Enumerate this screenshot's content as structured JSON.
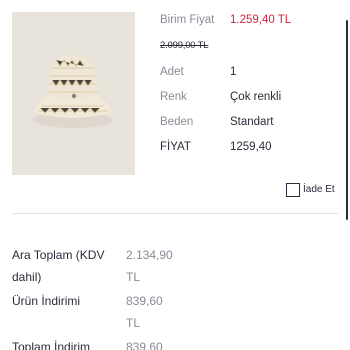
{
  "product": {
    "image_alt": "bucket hat",
    "unit_price_label": "Birim Fiyat",
    "unit_price_value": "1.259,40 TL",
    "old_price": "2.099,00 TL",
    "qty_label": "Adet",
    "qty_value": "1",
    "color_label": "Renk",
    "color_value": "Çok renkli",
    "size_label": "Beden",
    "size_value": "Standart",
    "price_label": "FİYAT",
    "price_value": "1259,40",
    "return_label": "İade Et"
  },
  "summary": {
    "subtotal_label_line1": "Ara Toplam (KDV",
    "subtotal_label_line2": "dahil)",
    "subtotal_value_line1": "2.134,90",
    "subtotal_value_line2": "TL",
    "discount_label": "Ürün İndirimi",
    "discount_value_line1": "839,60",
    "discount_value_line2": "TL",
    "total_discount_label": "Toplam İndirim",
    "total_discount_value": "839,60"
  },
  "colors": {
    "accent_red": "#d0263a",
    "text": "#2b2b3a",
    "muted": "#8a8a96"
  }
}
